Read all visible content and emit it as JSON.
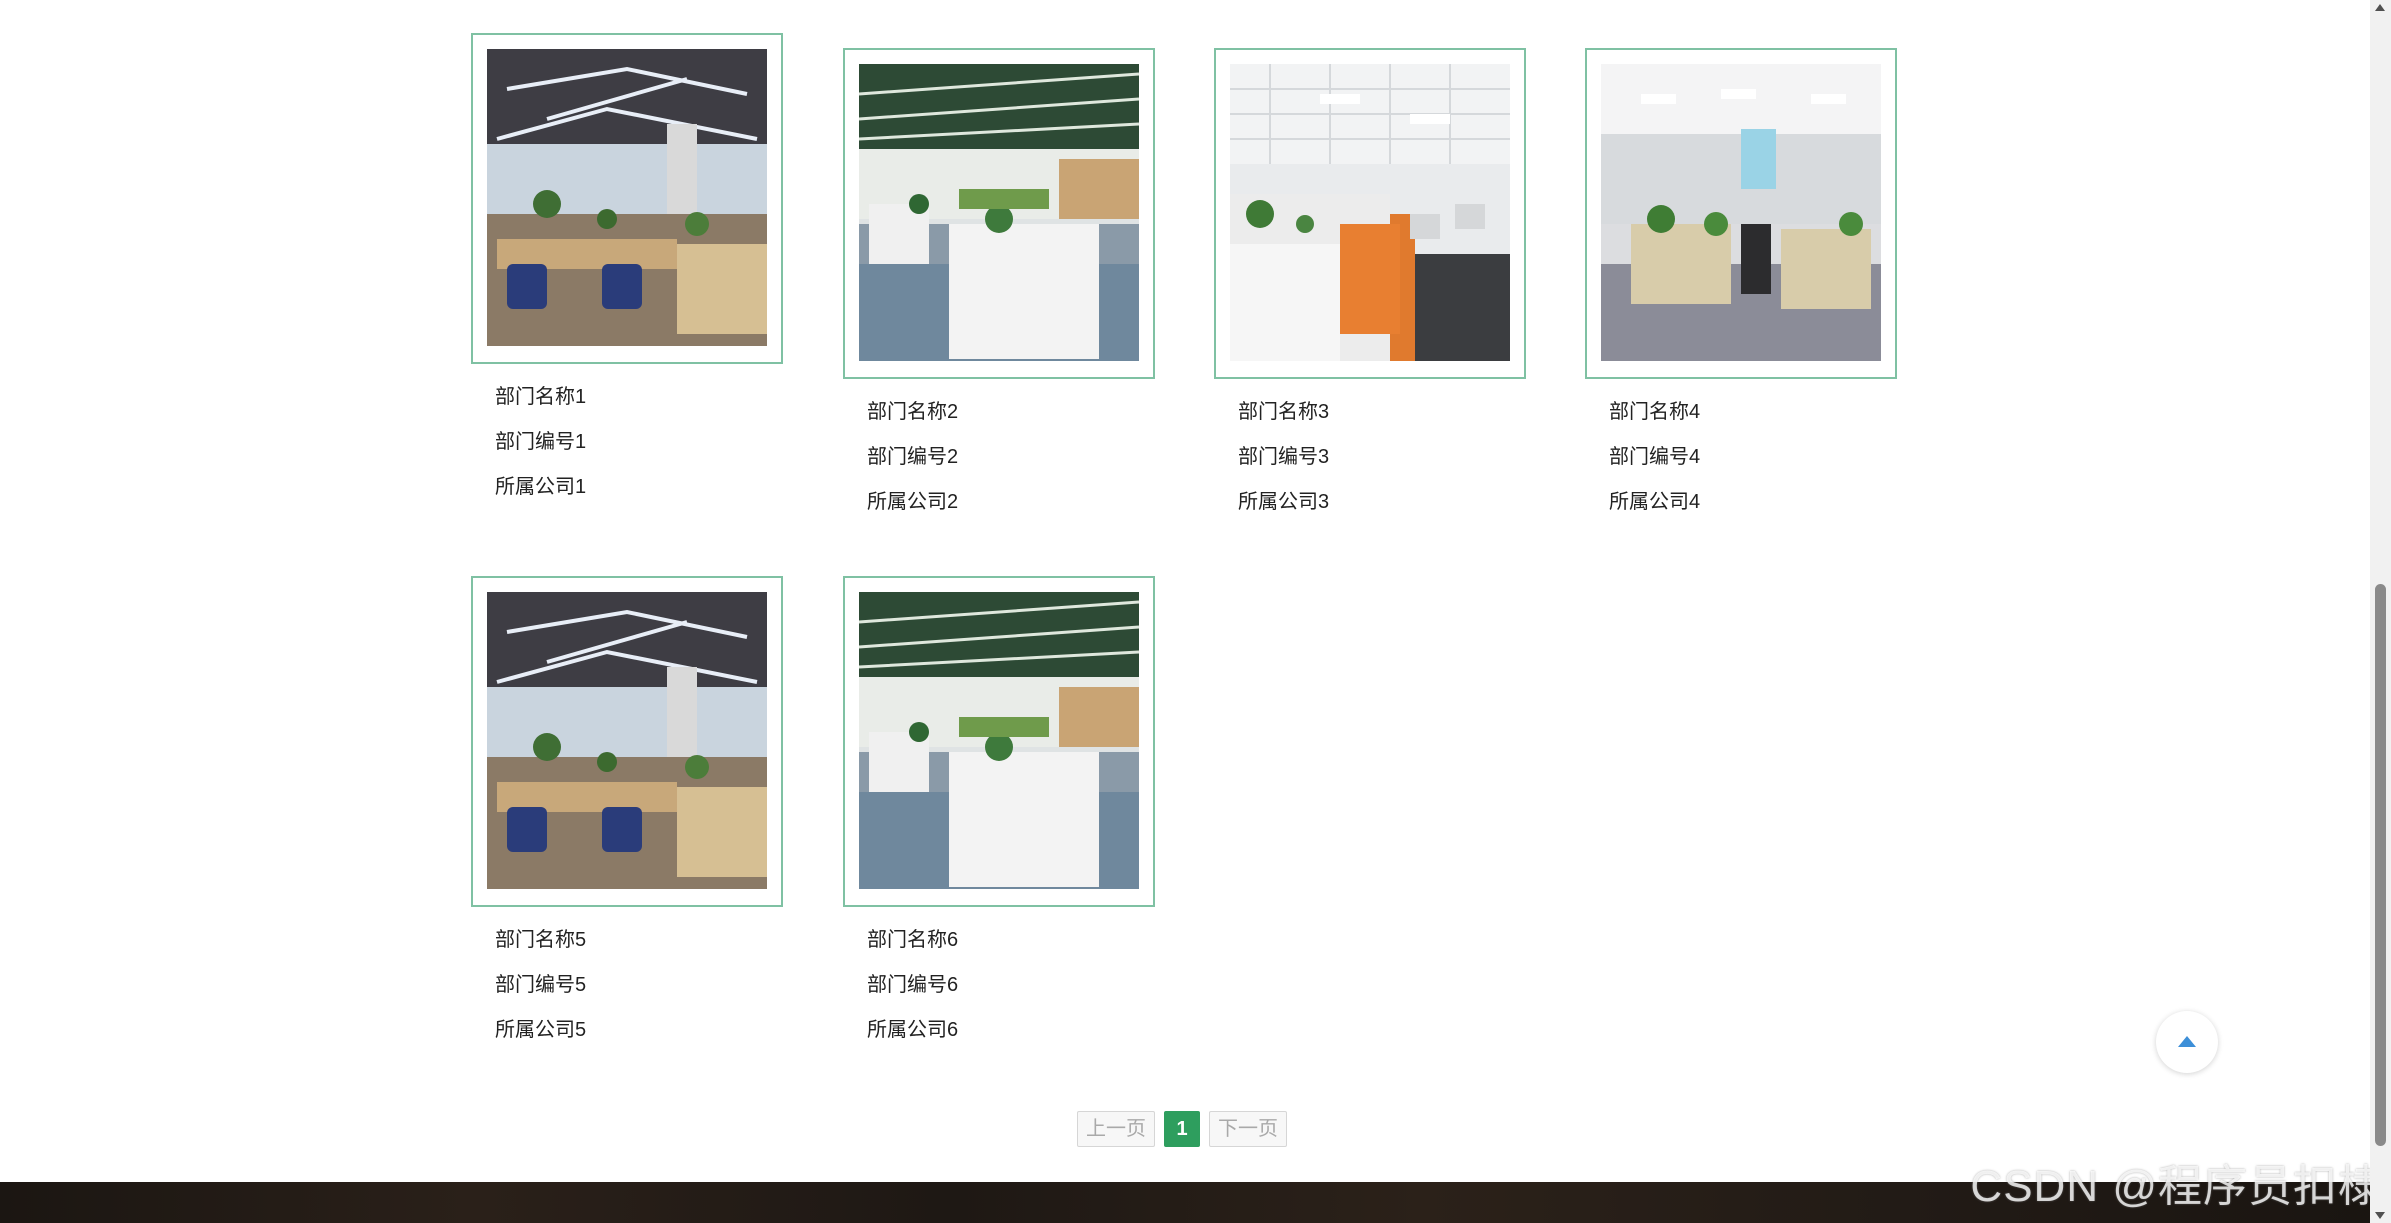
{
  "departments": [
    {
      "name": "部门名称1",
      "code": "部门编号1",
      "company": "所属公司1",
      "image": "office-photo-a"
    },
    {
      "name": "部门名称2",
      "code": "部门编号2",
      "company": "所属公司2",
      "image": "office-photo-b"
    },
    {
      "name": "部门名称3",
      "code": "部门编号3",
      "company": "所属公司3",
      "image": "office-photo-c"
    },
    {
      "name": "部门名称4",
      "code": "部门编号4",
      "company": "所属公司4",
      "image": "office-photo-d"
    },
    {
      "name": "部门名称5",
      "code": "部门编号5",
      "company": "所属公司5",
      "image": "office-photo-a"
    },
    {
      "name": "部门名称6",
      "code": "部门编号6",
      "company": "所属公司6",
      "image": "office-photo-b"
    }
  ],
  "pagination": {
    "prev_label": "上一页",
    "current_page": "1",
    "next_label": "下一页"
  },
  "back_to_top": {
    "icon": "arrow-up-icon",
    "color": "#3d8fd8"
  },
  "watermark": "CSDN @程序员扣棣",
  "colors": {
    "card_border": "#7fc1a3",
    "active_page": "#2e9e5e"
  }
}
